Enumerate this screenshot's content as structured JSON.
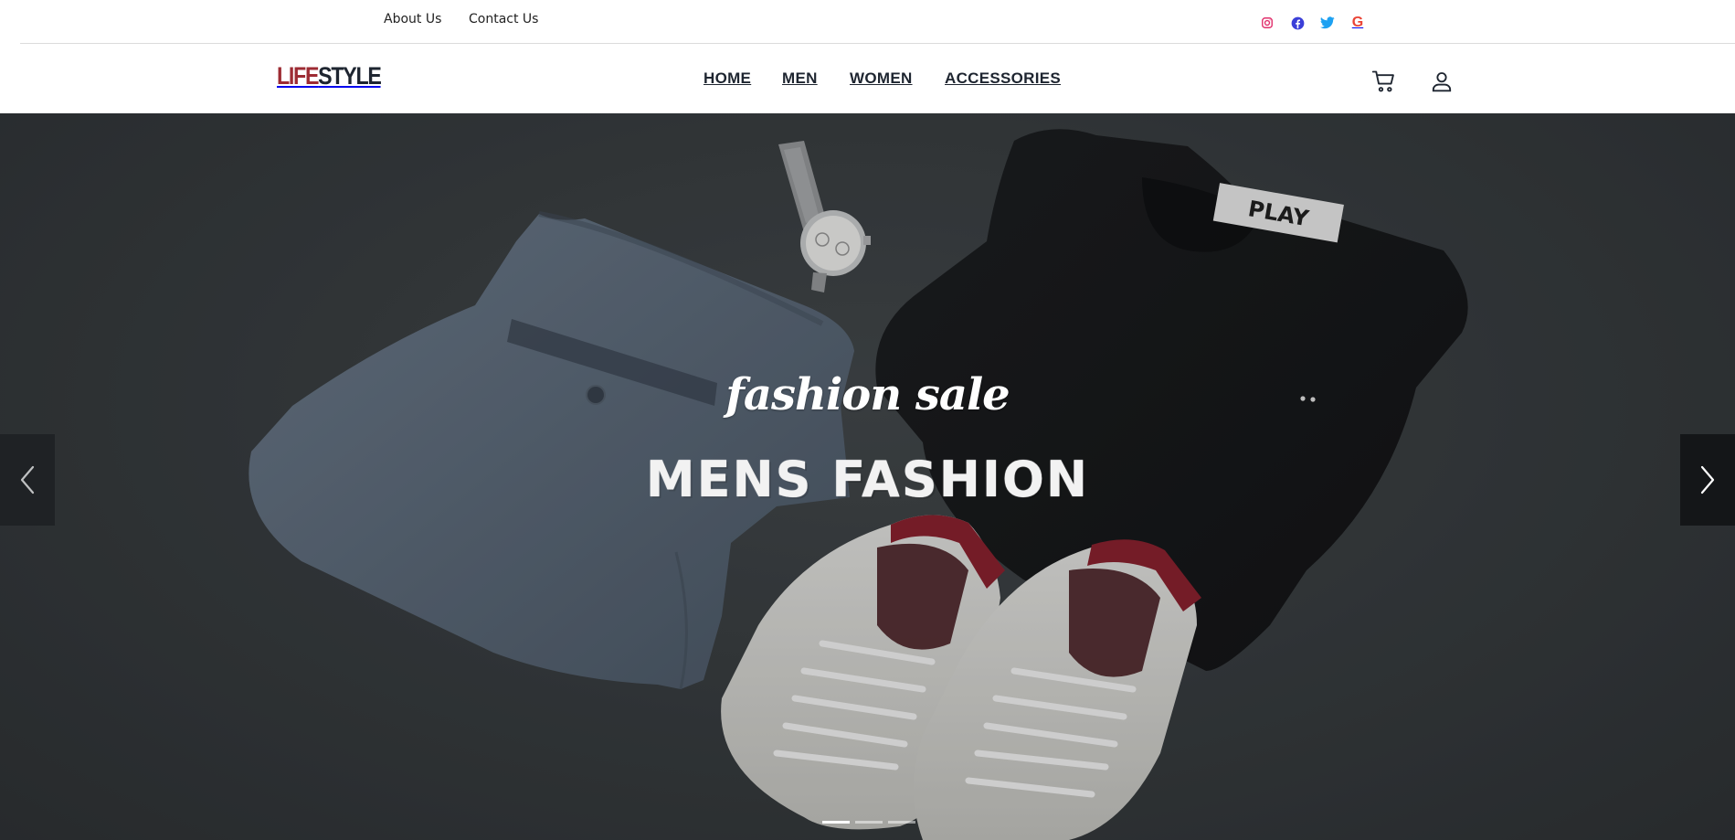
{
  "topbar": {
    "links": [
      {
        "label": "About Us"
      },
      {
        "label": "Contact Us"
      }
    ],
    "social": [
      {
        "icon": "instagram-icon",
        "color": "#e1306c"
      },
      {
        "icon": "facebook-icon",
        "color": "#3b3fd8"
      },
      {
        "icon": "twitter-icon",
        "color": "#1da1f2"
      },
      {
        "icon": "google-icon",
        "glyph": "G",
        "color": "#ea4335"
      }
    ]
  },
  "navbar": {
    "logo": {
      "part1": "LIFE",
      "part2": "STYLE",
      "color1": "#9d2b33",
      "color2": "#1e2530"
    },
    "items": [
      {
        "label": "HOME"
      },
      {
        "label": "MEN"
      },
      {
        "label": "WOMEN"
      },
      {
        "label": "ACCESSORIES"
      }
    ],
    "icons": [
      "cart-icon",
      "user-icon"
    ]
  },
  "hero": {
    "subtitle": "fashion sale",
    "title": "MENS FASHION",
    "label_text": "PLAY",
    "slides_total": 3,
    "active_slide": 1,
    "controls": [
      "chevron-left-icon",
      "chevron-right-icon"
    ]
  }
}
